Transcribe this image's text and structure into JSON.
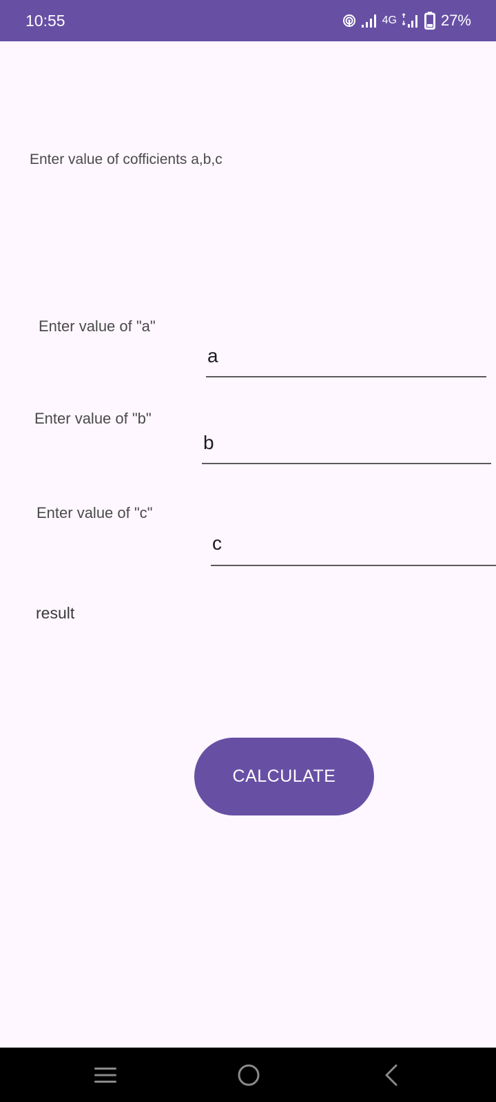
{
  "status_bar": {
    "time": "10:55",
    "network_label": "4G",
    "battery_percent": "27%",
    "icons": [
      "hotspot-icon",
      "signal-icon",
      "network-4g-icon",
      "signal-icon",
      "battery-icon"
    ],
    "background_color": "#6750A4"
  },
  "main": {
    "heading": "Enter value of cofficients a,b,c",
    "fields": [
      {
        "label": "Enter value of \"a\"",
        "placeholder": "a",
        "value": ""
      },
      {
        "label": "Enter value of \"b\"",
        "placeholder": "b",
        "value": ""
      },
      {
        "label": "Enter value of \"c\"",
        "placeholder": "c",
        "value": ""
      }
    ],
    "result_text": "result",
    "calculate_button": "CALCULATE",
    "accent_color": "#6750A4"
  },
  "nav_bar": {
    "icons": [
      "recent-apps-icon",
      "home-icon",
      "back-icon"
    ]
  }
}
